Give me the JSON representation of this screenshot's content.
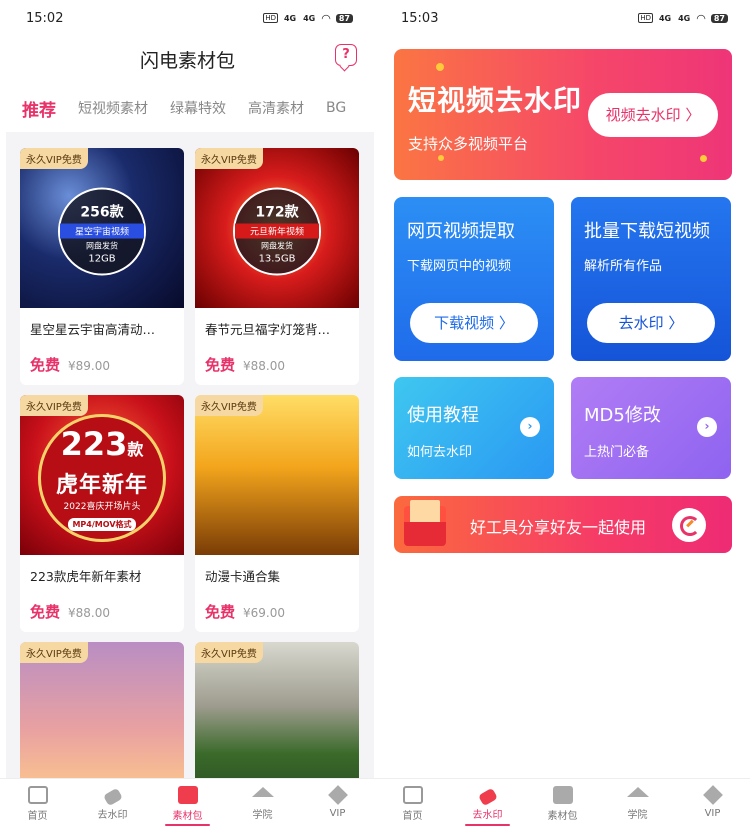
{
  "left": {
    "status": {
      "time": "15:02",
      "battery": "87"
    },
    "header": {
      "title": "闪电素材包"
    },
    "tabs": [
      "推荐",
      "短视频素材",
      "绿幕特效",
      "高清素材",
      "BG"
    ],
    "cards": [
      {
        "badge": "永久VIP免费",
        "title": "星空星云宇宙高清动…",
        "free": "免费",
        "price": "¥89.00",
        "overlay": {
          "num": "256款",
          "band": "星空宇宙视频",
          "note": "网盘发货",
          "size": "12GB"
        }
      },
      {
        "badge": "永久VIP免费",
        "title": "春节元旦福字灯笼背…",
        "free": "免费",
        "price": "¥88.00",
        "overlay": {
          "num": "172款",
          "band": "元旦新年视频",
          "note": "网盘发货",
          "size": "13.5GB"
        }
      },
      {
        "badge": "永久VIP免费",
        "title": "223款虎年新年素材",
        "free": "免费",
        "price": "¥88.00",
        "overlay": {
          "num": "223",
          "unit": "款",
          "main": "虎年新年",
          "sub": "2022喜庆开场片头",
          "fmt": "MP4/MOV格式"
        }
      },
      {
        "badge": "永久VIP免费",
        "title": "动漫卡通合集",
        "free": "免费",
        "price": "¥69.00"
      },
      {
        "badge": "永久VIP免费"
      },
      {
        "badge": "永久VIP免费"
      }
    ],
    "nav": [
      "首页",
      "去水印",
      "素材包",
      "学院",
      "VIP"
    ]
  },
  "right": {
    "status": {
      "time": "15:03",
      "battery": "87"
    },
    "banner": {
      "title": "短视频去水印",
      "subtitle": "支持众多视频平台",
      "button": "视频去水印 〉"
    },
    "tiles": [
      {
        "title": "网页视频提取",
        "subtitle": "下载网页中的视频",
        "button": "下载视频 〉"
      },
      {
        "title": "批量下载短视频",
        "subtitle": "解析所有作品",
        "button": "去水印 〉"
      }
    ],
    "small_tiles": [
      {
        "title": "使用教程",
        "subtitle": "如何去水印"
      },
      {
        "title": "MD5修改",
        "subtitle": "上热门必备"
      }
    ],
    "share": {
      "text": "好工具分享好友一起使用"
    },
    "nav": [
      "首页",
      "去水印",
      "素材包",
      "学院",
      "VIP"
    ]
  },
  "status_icons": {
    "hd": "HD",
    "sig1": "4G",
    "sig2": "4G"
  },
  "colors": {
    "accent": "#e8336a",
    "badge": "#f5d8a2",
    "blue": "#1f6bea"
  }
}
